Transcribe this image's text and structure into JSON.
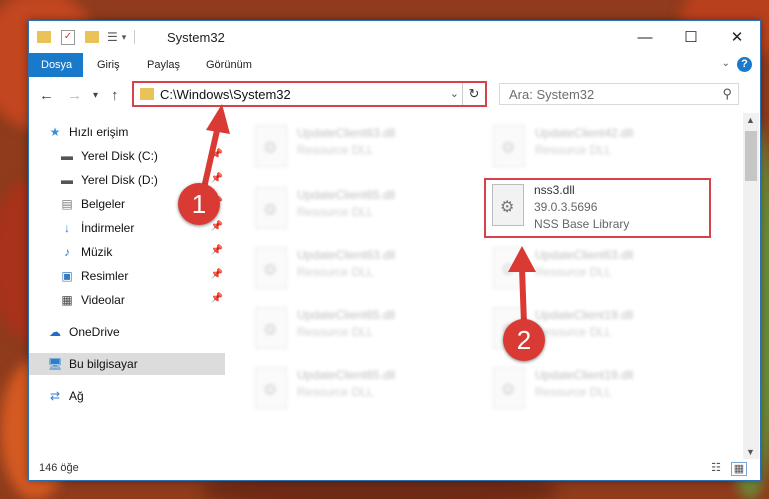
{
  "window": {
    "title": "System32",
    "controls": {
      "minimize": "—",
      "maximize": "☐",
      "close": "✕"
    }
  },
  "ribbon": {
    "tabs": [
      "Dosya",
      "Giriş",
      "Paylaş",
      "Görünüm"
    ],
    "help": "?"
  },
  "address": {
    "path": "C:\\Windows\\System32",
    "search_placeholder": "Ara: System32"
  },
  "nav": {
    "items": [
      {
        "label": "Hızlı erişim",
        "icon": "star-icon",
        "pinned": false
      },
      {
        "label": "Yerel Disk (C:)",
        "icon": "drive-icon",
        "pinned": true
      },
      {
        "label": "Yerel Disk (D:)",
        "icon": "drive-icon",
        "pinned": true
      },
      {
        "label": "Belgeler",
        "icon": "document-icon",
        "pinned": true
      },
      {
        "label": "İndirmeler",
        "icon": "download-icon",
        "pinned": true
      },
      {
        "label": "Müzik",
        "icon": "music-icon",
        "pinned": true
      },
      {
        "label": "Resimler",
        "icon": "picture-icon",
        "pinned": true
      },
      {
        "label": "Videolar",
        "icon": "video-icon",
        "pinned": true
      },
      {
        "label": "OneDrive",
        "icon": "cloud-icon",
        "pinned": false
      },
      {
        "label": "Bu bilgisayar",
        "icon": "computer-icon",
        "pinned": false,
        "selected": true
      },
      {
        "label": "Ağ",
        "icon": "network-icon",
        "pinned": false
      }
    ]
  },
  "files": [
    {
      "name": "UpdateClient63.dll",
      "desc": "Resource DLL"
    },
    {
      "name": "UpdateClient42.dll",
      "desc": "Resource DLL"
    },
    {
      "name": "UpdateClient65.dll",
      "desc": "Resource DLL"
    },
    {
      "name": "UpdateClient63.dll",
      "desc": "Resource DLL"
    },
    {
      "name": "UpdateClient63.dll",
      "desc": "Resource DLL"
    },
    {
      "name": "UpdateClient65.dll",
      "desc": "Resource DLL"
    },
    {
      "name": "UpdateClient19.dll",
      "desc": "Resource DLL"
    },
    {
      "name": "UpdateClient65.dll",
      "desc": "Resource DLL"
    },
    {
      "name": "UpdateClient19.dll",
      "desc": "Resource DLL"
    }
  ],
  "highlighted_file": {
    "name": "nss3.dll",
    "version": "39.0.3.5696",
    "desc": "NSS Base Library"
  },
  "status": {
    "count": "146 öğe"
  },
  "annotations": {
    "step1": "1",
    "step2": "2"
  },
  "colors": {
    "accent": "#1979ca",
    "highlight": "#d9414a",
    "badge": "#d93a33"
  }
}
